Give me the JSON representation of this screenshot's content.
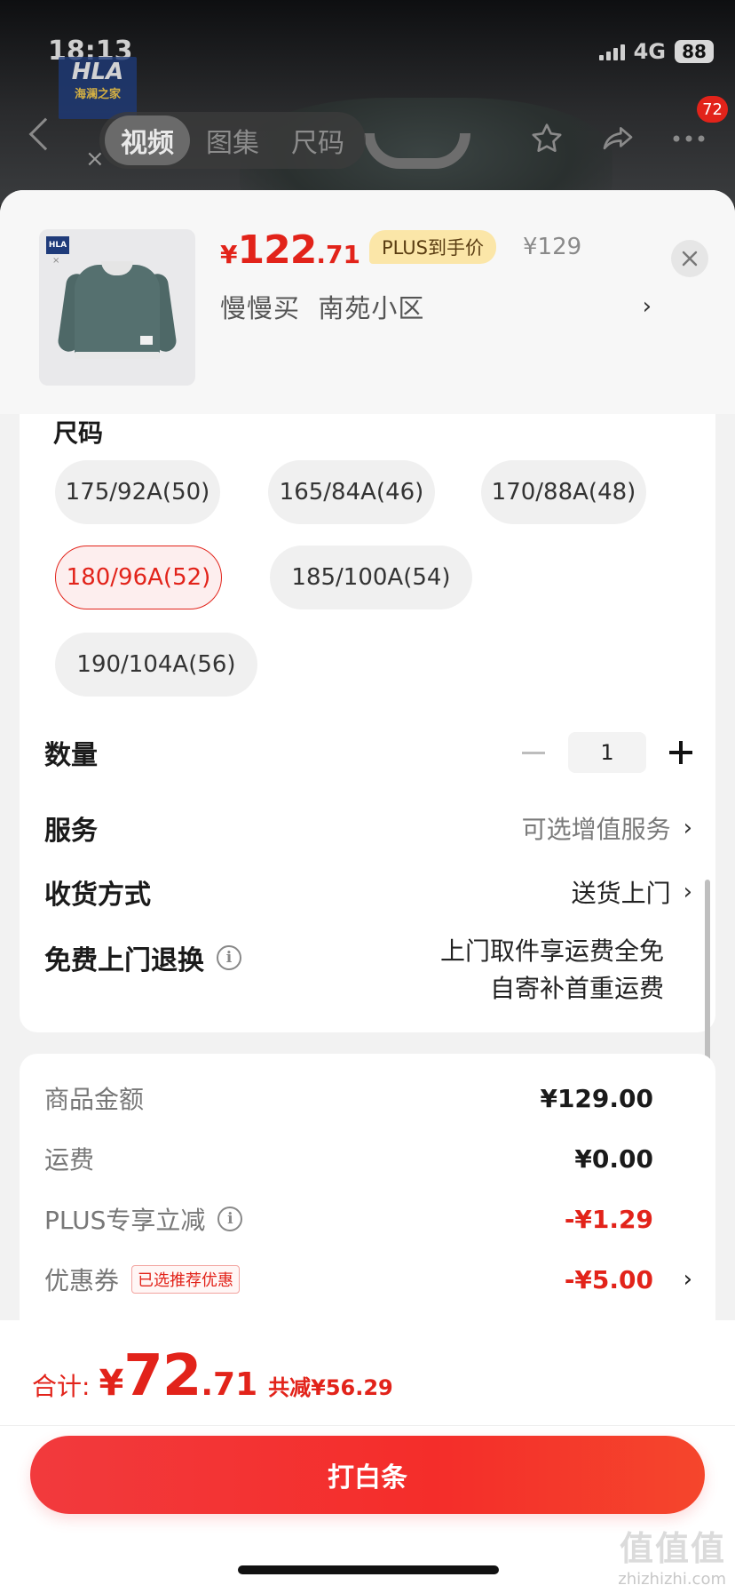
{
  "status_bar": {
    "time": "18:13",
    "network": "4G",
    "battery": "88"
  },
  "background_page": {
    "brand_logo_top": "HLA",
    "brand_logo_bottom": "海澜之家",
    "media_tabs": [
      "视频",
      "图集",
      "尺码"
    ],
    "active_media_tab": 0,
    "cart_badge": "72"
  },
  "product": {
    "price_symbol": "¥",
    "price_integer": "122",
    "price_decimal": ".71",
    "plus_label": "PLUS到手价",
    "original_price": "¥129",
    "address": "慢慢买  南苑小区"
  },
  "size_section": {
    "title": "尺码",
    "options": [
      {
        "label": "175/92A(50)",
        "selected": false
      },
      {
        "label": "165/84A(46)",
        "selected": false
      },
      {
        "label": "170/88A(48)",
        "selected": false
      },
      {
        "label": "180/96A(52)",
        "selected": true
      },
      {
        "label": "185/100A(54)",
        "selected": false
      },
      {
        "label": "190/104A(56)",
        "selected": false
      }
    ]
  },
  "quantity": {
    "label": "数量",
    "value": "1"
  },
  "service": {
    "label": "服务",
    "value": "可选增值服务"
  },
  "delivery": {
    "label": "收货方式",
    "value": "送货上门"
  },
  "free_return": {
    "label": "免费上门退换",
    "line1": "上门取件享运费全免",
    "line2": "自寄补首重运费"
  },
  "summary": {
    "goods_label": "商品金额",
    "goods_value": "¥129.00",
    "shipping_label": "运费",
    "shipping_value": "¥0.00",
    "plus_label": "PLUS专享立减",
    "plus_value": "-¥1.29",
    "coupon_label": "优惠券",
    "coupon_tag": "已选推荐优惠",
    "coupon_value": "-¥5.00"
  },
  "footer": {
    "total_label": "合计:",
    "total_symbol": "¥",
    "total_integer": "72",
    "total_decimal": ".71",
    "saved": "共减¥56.29",
    "pay_button": "打白条"
  },
  "watermark": {
    "line1": "值值值",
    "line2": "zhizhizhi.com"
  },
  "colors": {
    "accent": "#e2231a",
    "sheet_bg": "#f2f2f2",
    "plus_tag_bg": "#fbe6a8"
  }
}
